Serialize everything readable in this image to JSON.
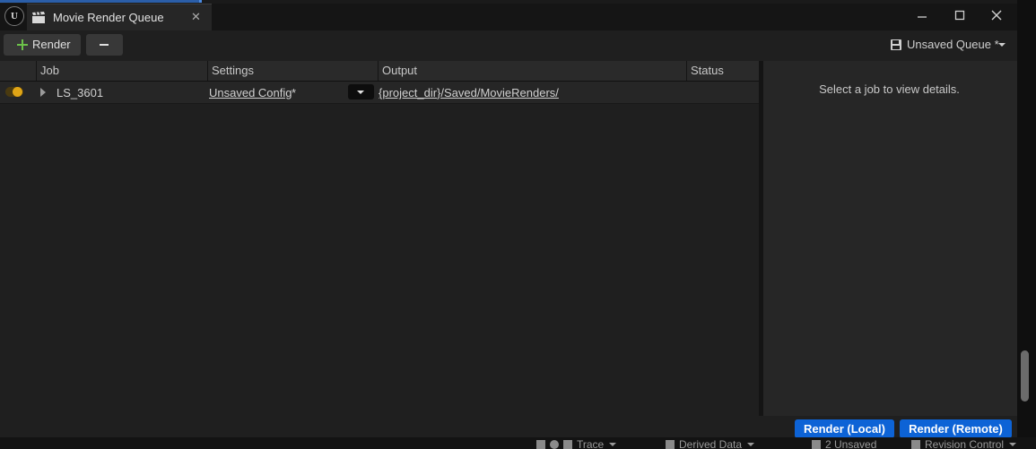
{
  "window": {
    "tab_title": "Movie Render Queue",
    "tab_icon": "clapperboard-icon",
    "logo_text": "U"
  },
  "toolbar": {
    "render_label": "Render",
    "queue_label": "Unsaved Queue *"
  },
  "table": {
    "columns": [
      "Job",
      "Settings",
      "Output",
      "Status"
    ],
    "rows": [
      {
        "enabled": true,
        "job": "LS_3601",
        "settings": "Unsaved Config",
        "settings_dirty": "*",
        "output": "{project_dir}/Saved/MovieRenders/",
        "status": ""
      }
    ]
  },
  "details": {
    "empty_message": "Select a job to view details."
  },
  "footer": {
    "render_local": "Render (Local)",
    "render_remote": "Render (Remote)"
  },
  "statusbar": {
    "items": [
      "Trace",
      "Derived Data",
      "2 Unsaved",
      "Revision Control"
    ]
  },
  "colors": {
    "accent": "#0d63d6",
    "toggle_on": "#e0a516",
    "background": "#1f1f1f",
    "panel": "#262626"
  }
}
